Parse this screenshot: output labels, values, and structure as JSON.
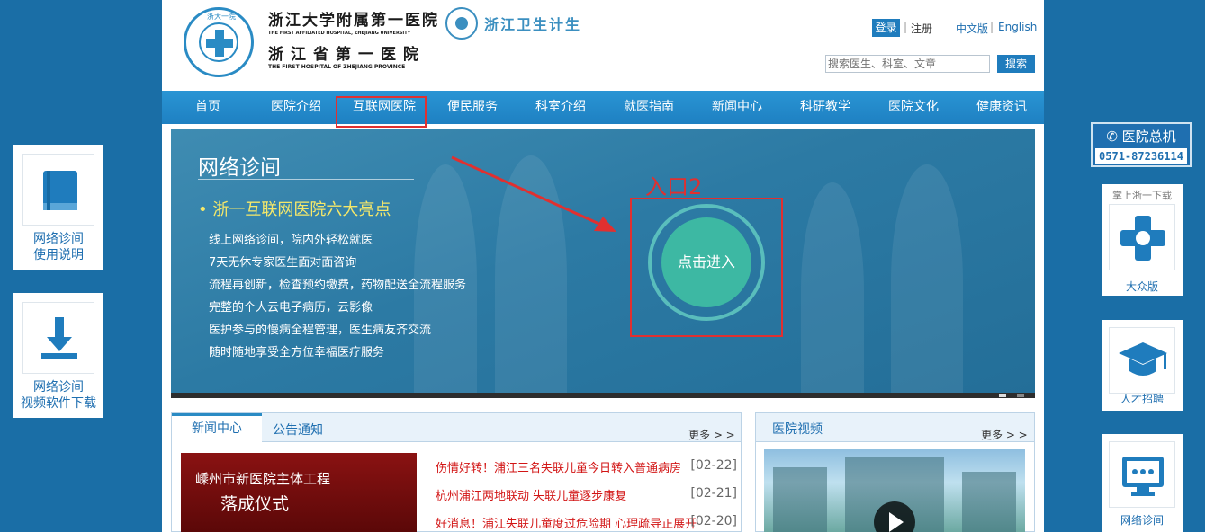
{
  "header": {
    "seal_text": "浙大一院",
    "hospital_name_cn": "浙江大学附属第一医院",
    "hospital_name_en": "THE FIRST AFFILIATED HOSPITAL, ZHEJIANG UNIVERSITY",
    "province_name_cn": "浙江省第一医院",
    "province_name_en": "THE FIRST HOSPITAL OF ZHEJIANG PROVINCE",
    "health_commission": "浙江卫生计生",
    "login_label": "登录",
    "register_label": "注册",
    "lang_cn": "中文版",
    "lang_en": "English",
    "search_placeholder": "搜索医生、科室、文章",
    "search_button": "搜索"
  },
  "nav": {
    "items": [
      "首页",
      "医院介绍",
      "互联网医院",
      "便民服务",
      "科室介绍",
      "就医指南",
      "新闻中心",
      "科研教学",
      "医院文化",
      "健康资讯"
    ],
    "highlighted_index": 2
  },
  "hero": {
    "title": "网络诊间",
    "bullet": "• 浙一互联网医院六大亮点",
    "lines": [
      "线上网络诊间，院内外轻松就医",
      "7天无休专家医生面对面咨询",
      "流程再创新，检查预约缴费，药物配送全流程服务",
      "完整的个人云电子病历，云影像",
      "医护参与的慢病全程管理，医生病友齐交流",
      "随时随地享受全方位幸福医疗服务"
    ],
    "entry_annotation": "入口2",
    "enter_button": "点击进入"
  },
  "news": {
    "tab_active": "新闻中心",
    "tab_other": "公告通知",
    "more": "更多 > >",
    "photo_caption_1": "嵊州市新医院主体工程",
    "photo_caption_2": "落成仪式",
    "items": [
      {
        "title": "伤情好转！浦江三名失联儿童今日转入普通病房",
        "date": "[02-22]"
      },
      {
        "title": "杭州浦江两地联动 失联儿童逐步康复",
        "date": "[02-21]"
      },
      {
        "title": "好消息！浦江失联儿童度过危险期 心理疏导正展开",
        "date": "[02-20]"
      }
    ]
  },
  "video": {
    "title": "医院视频",
    "more": "更多 > >"
  },
  "left_side": {
    "card1_line1": "网络诊间",
    "card1_line2": "使用说明",
    "card2_line1": "网络诊间",
    "card2_line2": "视频软件下载"
  },
  "right_side": {
    "hotline_label": "医院总机",
    "hotline_number": "0571-87236114",
    "app_caption": "掌上浙一下载",
    "app_label": "大众版",
    "recruit_label": "人才招聘",
    "clinic_label": "网络诊间"
  },
  "colors": {
    "page_bg": "#1a6ea6",
    "brand_blue": "#1f7cbd",
    "annotation_red": "#e03030",
    "enter_teal": "#3db8a3",
    "news_red": "#d21515"
  }
}
